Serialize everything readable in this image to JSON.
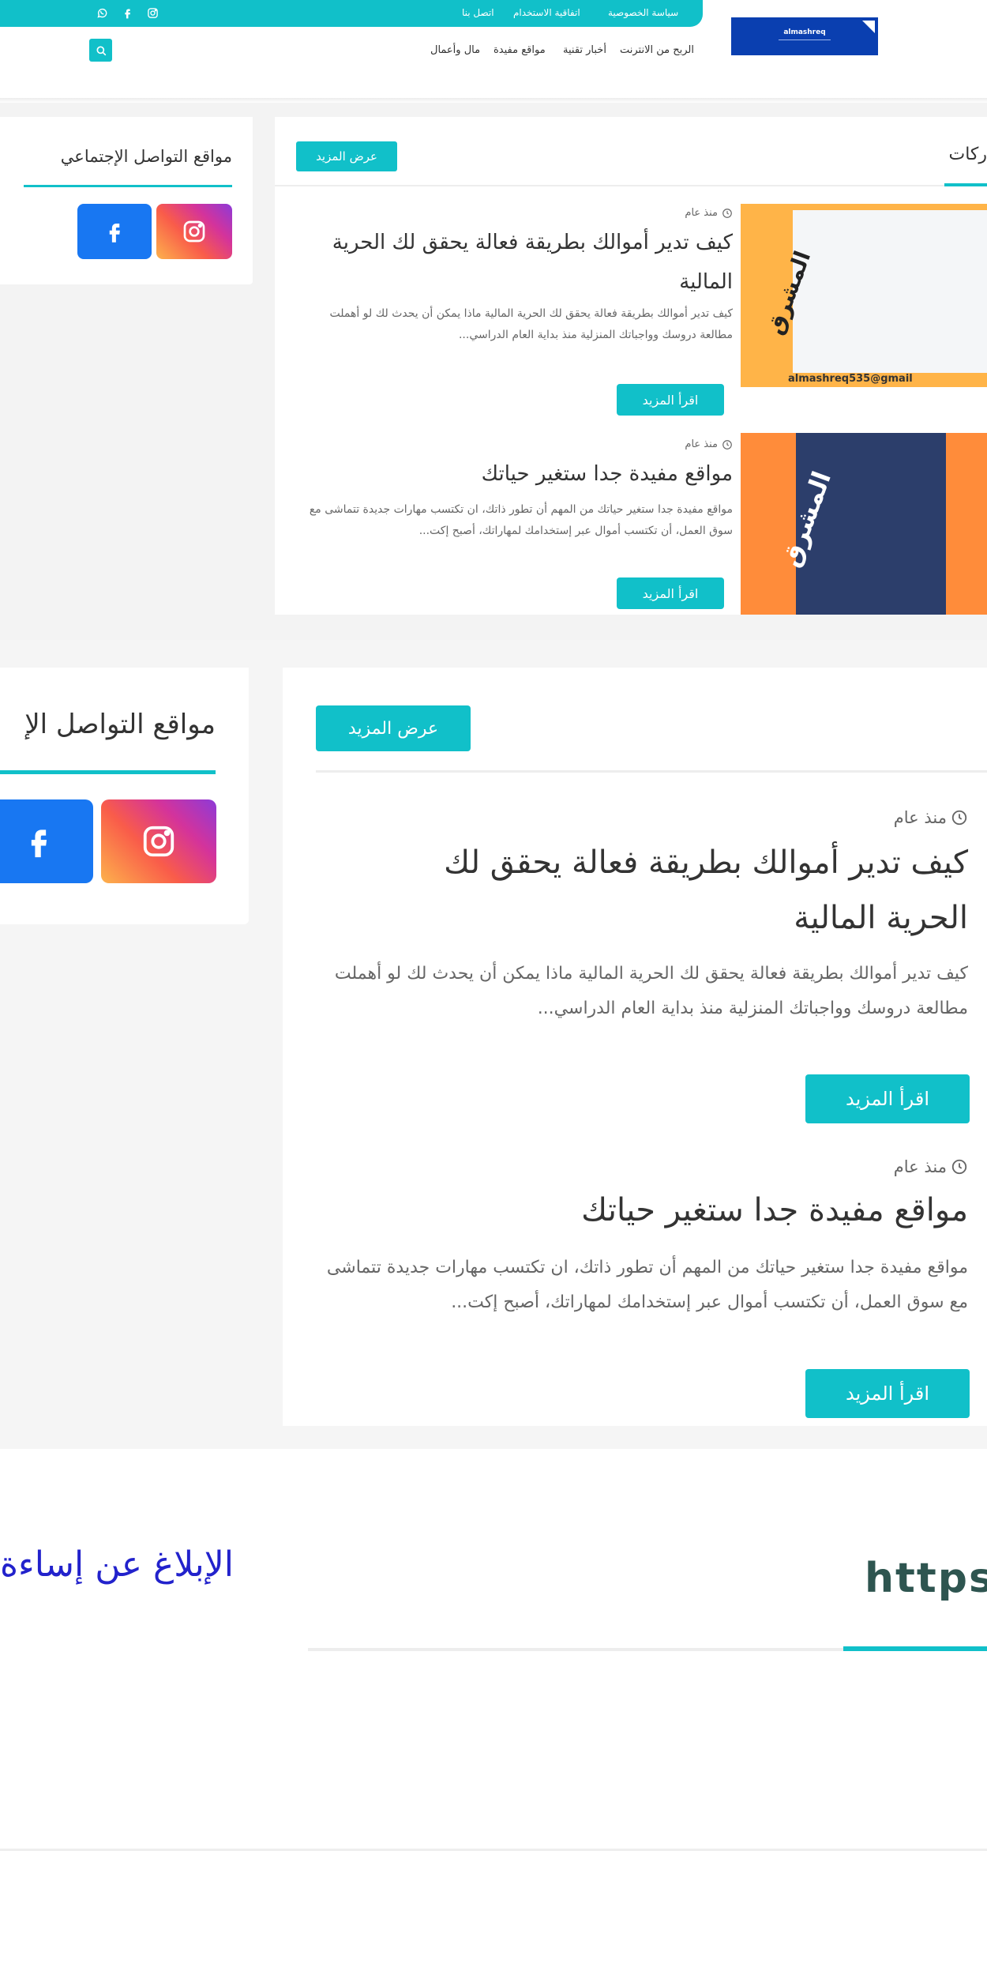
{
  "topbar": {
    "links": [
      "سياسة الخصوصية",
      "اتفاقية الاستخدام",
      "اتصل بنا"
    ],
    "social_icons": [
      "instagram-icon",
      "facebook-icon",
      "whatsapp-icon"
    ]
  },
  "logo": {
    "text": "almashreq"
  },
  "nav": {
    "items": [
      "الربح من الانترنت",
      "أخبار تقنية",
      "مواقع مفيدة",
      "مال وأعمال"
    ]
  },
  "section": {
    "title": "ركات",
    "more_label": "عرض المزيد"
  },
  "sidebar": {
    "title": "مواقع التواصل الإجتماعي",
    "title_zoomed": "مواقع التواصل الإ"
  },
  "posts": [
    {
      "date": "منذ عام",
      "title": "كيف تدير أموالك بطريقة فعالة يحقق لك الحرية المالية",
      "excerpt": "كيف تدير أموالك بطريقة فعالة يحقق لك الحرية المالية ماذا يمكن أن يحدث لك لو أهملت مطالعة دروسك وواجباتك المنزلية منذ بداية العام الدراسي...",
      "read_more": "اقرأ المزيد",
      "thumb_text": "المشرق",
      "thumb_caption": "almashreq535@gmail"
    },
    {
      "date": "منذ عام",
      "title": "مواقع مفيدة جدا ستغير حياتك",
      "excerpt": "مواقع مفيدة جدا ستغير حياتك من المهم أن تطور ذاتك، ان تكتسب مهارات جديدة تتماشى مع سوق العمل، أن تكتسب أموال عبر إستخدامك لمهاراتك، أصبح إكت...",
      "read_more": "اقرأ المزيد",
      "thumb_text": "المشرق"
    }
  ],
  "footer": {
    "url_text": "https:",
    "report_text": "الإبلاغ عن إساءة"
  },
  "colors": {
    "accent": "#11c0c9",
    "facebook": "#1877f2",
    "logo_bg": "#0a3fb0"
  }
}
